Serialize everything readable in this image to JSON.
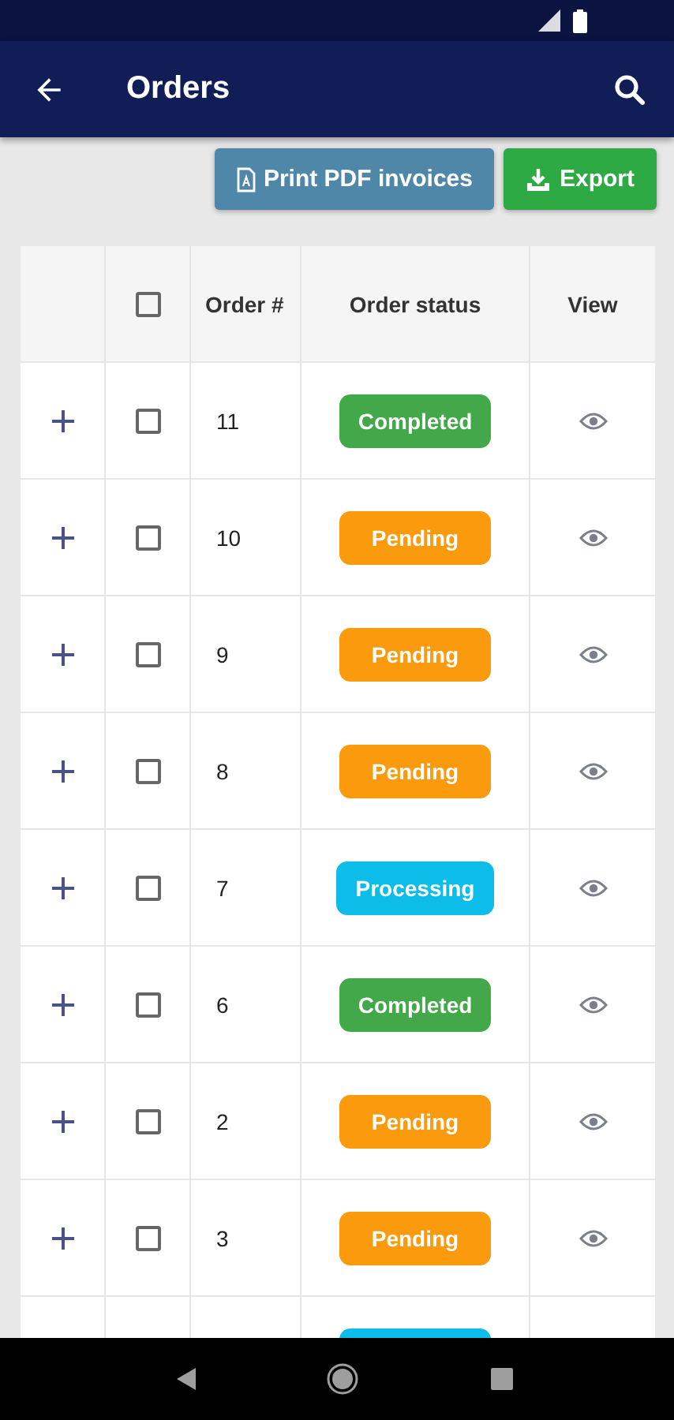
{
  "app_bar": {
    "title": "Orders"
  },
  "actions": [
    {
      "kind": "pdf",
      "label": "Print PDF invoices"
    },
    {
      "kind": "export",
      "label": "Export"
    }
  ],
  "table": {
    "header_checked": false,
    "columns": [
      "Order #",
      "Order status",
      "View"
    ],
    "rows": [
      {
        "checked": false,
        "order": "11",
        "color": "#43a84a",
        "status": "Completed"
      },
      {
        "checked": false,
        "order": "10",
        "color": "#fb9a0c",
        "status": "Pending"
      },
      {
        "checked": false,
        "order": "9",
        "color": "#fb9a0c",
        "status": "Pending"
      },
      {
        "checked": false,
        "order": "8",
        "color": "#fb9a0c",
        "status": "Pending"
      },
      {
        "checked": false,
        "order": "7",
        "color": "#0dbde9",
        "status": "Processing"
      },
      {
        "checked": false,
        "order": "6",
        "color": "#43a84a",
        "status": "Completed"
      },
      {
        "checked": false,
        "order": "2",
        "color": "#fb9a0c",
        "status": "Pending"
      },
      {
        "checked": false,
        "order": "3",
        "color": "#fb9a0c",
        "status": "Pending"
      },
      {
        "color": "#0dbde9"
      }
    ]
  }
}
